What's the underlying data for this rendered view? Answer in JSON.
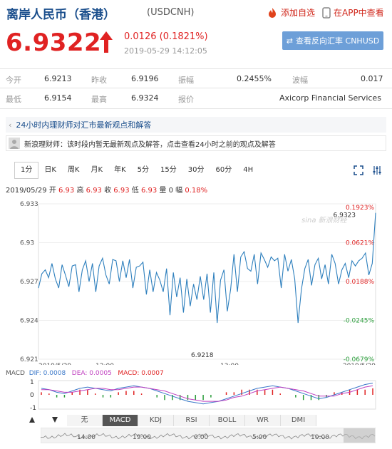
{
  "header": {
    "title": "离岸人民币（香港）",
    "code": "(USDCNH)",
    "add_watch": "添加自选",
    "open_app": "在APP中查看"
  },
  "quote": {
    "price": "6.9322",
    "change": "0.0126 (0.1821%)",
    "timestamp": "2019-05-29 14:12:05",
    "reverse_button": "查看反向汇率 CNHUSD",
    "up_color": "#e02222"
  },
  "stats": {
    "open_label": "今开",
    "open": "6.9213",
    "prev_label": "昨收",
    "prev": "6.9196",
    "amp_label": "振幅",
    "amp": "0.2455%",
    "wave_label": "波幅",
    "wave": "0.017",
    "low_label": "最低",
    "low": "6.9154",
    "high_label": "最高",
    "high": "6.9324",
    "quote_label": "报价",
    "quote_src": "Axicorp Financial Services"
  },
  "info": {
    "banner": "24小时内理财师对汇市最新观点和解答",
    "advisor": "新浪理财师：该时段内暂无最新观点及解答，点击查看24小时之前的观点及解答"
  },
  "tabs": [
    "1分",
    "日K",
    "周K",
    "月K",
    "年K",
    "5分",
    "15分",
    "30分",
    "60分",
    "4H"
  ],
  "ohlc": {
    "date": "2019/05/29",
    "o_label": "开",
    "o": "6.93",
    "h_label": "高",
    "h": "6.93",
    "c_label": "收",
    "c": "6.93",
    "l_label": "低",
    "l": "6.93",
    "v_label": "量",
    "v": "0",
    "p_label": "幅",
    "p": "0.18%"
  },
  "watermark": "sina 新浪财经",
  "chart_data": {
    "type": "line",
    "y_ticks": [
      "6.933",
      "6.93",
      "6.927",
      "6.924",
      "6.921"
    ],
    "y_right_ticks": [
      "0.1923%",
      "0.0621%",
      "0.0188%",
      "-0.0245%",
      "-0.0679%"
    ],
    "x_ticks": [
      "2019/5/29",
      "12:00",
      "13:00",
      "2019/5/29"
    ],
    "last_label": "6.9323",
    "low_label": "6.9218",
    "ylim": [
      6.921,
      6.933
    ],
    "series": [
      {
        "values": [
          6.9265,
          6.9276,
          6.9279,
          6.9273,
          6.9284,
          6.9272,
          6.9265,
          6.9283,
          6.9275,
          6.9266,
          6.9282,
          6.9283,
          6.9262,
          6.9279,
          6.9286,
          6.927,
          6.9284,
          6.9262,
          6.9282,
          6.9288,
          6.9275,
          6.9268,
          6.9287,
          6.9286,
          6.927,
          6.9286,
          6.9273,
          6.9287,
          6.9265,
          6.9281,
          6.9282,
          6.9285,
          6.926,
          6.9279,
          6.9262,
          6.9277,
          6.9271,
          6.9262,
          6.928,
          6.9244,
          6.9277,
          6.9258,
          6.9273,
          6.9246,
          6.9272,
          6.9251,
          6.9268,
          6.9256,
          6.9274,
          6.9256,
          6.9276,
          6.9246,
          6.9277,
          6.9238,
          6.9271,
          6.9279,
          6.9247,
          6.9264,
          6.9291,
          6.9262,
          6.9289,
          6.9293,
          6.928,
          6.9278,
          6.9291,
          6.9268,
          6.9292,
          6.9287,
          6.9281,
          6.9289,
          6.9286,
          6.9288,
          6.9265,
          6.9291,
          6.9278,
          6.9287,
          6.9272,
          6.9238,
          6.9264,
          6.928,
          6.9287,
          6.9267,
          6.9283,
          6.9288,
          6.9272,
          6.9283,
          6.9268,
          6.9291,
          6.9284,
          6.9268,
          6.9279,
          6.9284,
          6.9273,
          6.9286,
          6.9282,
          6.9286,
          6.9288,
          6.9292,
          6.9275,
          6.9284,
          6.9323
        ]
      }
    ]
  },
  "macd": {
    "label": "MACD",
    "dif": "DIF: 0.0008",
    "dea": "DEA: 0.0005",
    "macd": "MACD: 0.0007",
    "ticks": [
      "1",
      "0",
      "-1"
    ],
    "dif_values": [
      0.5,
      0.4,
      0.2,
      0.1,
      0.3,
      0.5,
      0.6,
      0.5,
      0.4,
      0.3,
      0.5,
      0.6,
      0.7,
      0.6,
      0.5,
      0.3,
      0.1,
      -0.1,
      -0.3,
      -0.5,
      -0.6,
      -0.7,
      -0.6,
      -0.5,
      -0.3,
      -0.1,
      0.1,
      0.3,
      0.5,
      0.6,
      0.7,
      0.6,
      0.5,
      0.3,
      0.1,
      -0.1,
      -0.3,
      -0.2,
      0.0,
      0.2,
      0.4,
      0.6,
      0.8,
      0.9
    ],
    "dea_values": [
      0.4,
      0.4,
      0.3,
      0.2,
      0.2,
      0.3,
      0.4,
      0.5,
      0.5,
      0.4,
      0.4,
      0.5,
      0.6,
      0.6,
      0.5,
      0.4,
      0.3,
      0.1,
      -0.1,
      -0.3,
      -0.4,
      -0.5,
      -0.5,
      -0.5,
      -0.4,
      -0.2,
      -0.1,
      0.1,
      0.3,
      0.4,
      0.5,
      0.6,
      0.5,
      0.4,
      0.3,
      0.1,
      -0.1,
      -0.1,
      -0.1,
      0.1,
      0.2,
      0.4,
      0.6,
      0.7
    ],
    "hist": [
      0.2,
      0.1,
      -0.2,
      -0.2,
      0.2,
      0.4,
      0.4,
      0.1,
      -0.2,
      -0.2,
      0.2,
      0.3,
      0.3,
      0.1,
      0.0,
      -0.2,
      -0.4,
      -0.4,
      -0.4,
      -0.4,
      -0.4,
      -0.4,
      -0.2,
      0.0,
      0.2,
      0.2,
      0.4,
      0.4,
      0.4,
      0.4,
      0.4,
      0.1,
      0.0,
      -0.2,
      -0.4,
      -0.4,
      -0.4,
      -0.2,
      0.2,
      0.2,
      0.4,
      0.4,
      0.4,
      0.5
    ]
  },
  "bottom_tabs": [
    "无",
    "MACD",
    "KDJ",
    "RSI",
    "BOLL",
    "WR",
    "DMI"
  ],
  "nav_times": [
    "14:00",
    "19:00",
    "0:00",
    "5:00",
    "10:00"
  ]
}
